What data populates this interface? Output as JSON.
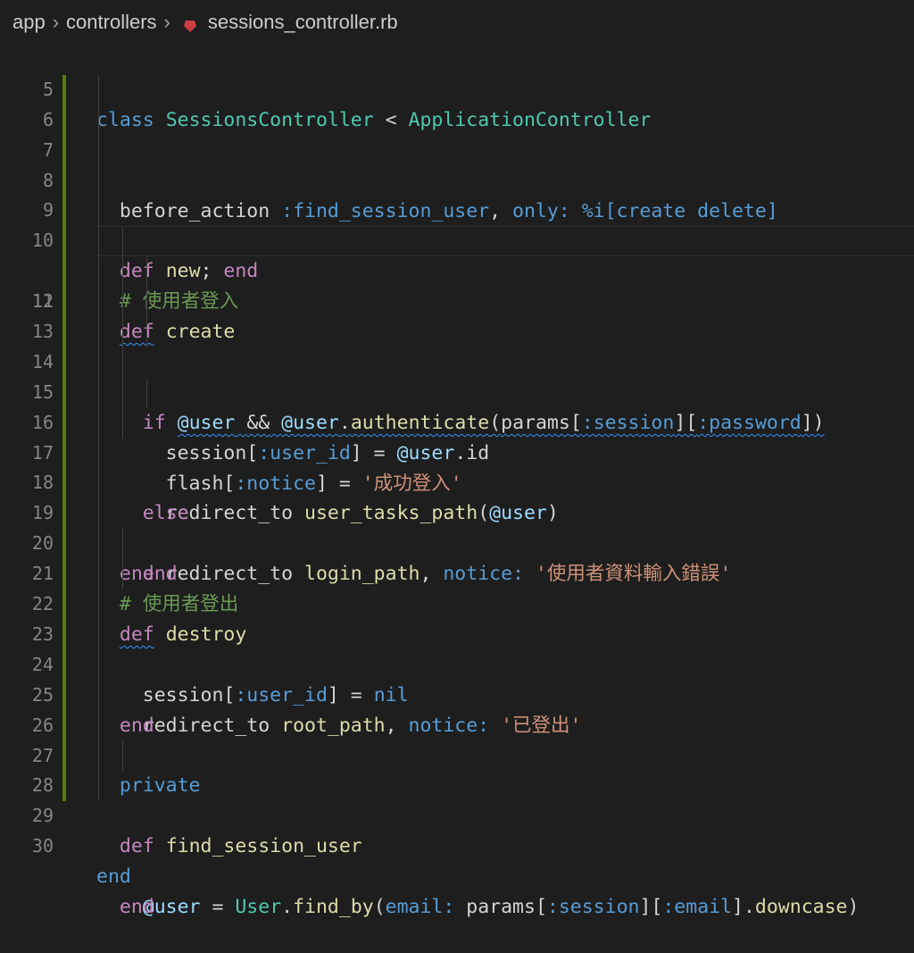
{
  "breadcrumb": {
    "part1": "app",
    "part2": "controllers",
    "file": "sessions_controller.rb",
    "icon": "ruby-icon"
  },
  "editor": {
    "lines": [
      {
        "n": "5"
      },
      {
        "n": "6"
      },
      {
        "n": "7"
      },
      {
        "n": "8"
      },
      {
        "n": "9"
      },
      {
        "n": "10"
      },
      {
        "n": "11"
      },
      {
        "n": "12"
      },
      {
        "n": "13"
      },
      {
        "n": "14"
      },
      {
        "n": "15"
      },
      {
        "n": "16"
      },
      {
        "n": "17"
      },
      {
        "n": "18"
      },
      {
        "n": "19"
      },
      {
        "n": "20"
      },
      {
        "n": "21"
      },
      {
        "n": "22"
      },
      {
        "n": "23"
      },
      {
        "n": "24"
      },
      {
        "n": "25"
      },
      {
        "n": "26"
      },
      {
        "n": "27"
      },
      {
        "n": "28"
      },
      {
        "n": "29"
      },
      {
        "n": "30"
      }
    ],
    "tokens": {
      "l5": [
        "class",
        "SessionsController",
        "<",
        "ApplicationController"
      ],
      "l6": [
        "before_action",
        ":find_session_user",
        "only:",
        "%i[create delete]"
      ],
      "l8": [
        "def",
        "new",
        "end"
      ],
      "l9": "# 使用者登入",
      "l10": [
        "def",
        "create"
      ],
      "l11": [
        "if",
        "@user",
        "&&",
        "@user",
        "authenticate",
        "params",
        ":session",
        ":password"
      ],
      "l12": [
        "session",
        ":user_id",
        "@user",
        "id"
      ],
      "l13": [
        "flash",
        ":notice",
        "'成功登入'"
      ],
      "l14": [
        "redirect_to",
        "user_tasks_path",
        "@user"
      ],
      "l15": "else",
      "l16": [
        "redirect_to",
        "login_path",
        "notice:",
        "'使用者資料輸入錯誤'"
      ],
      "l17": "end",
      "l18": "end",
      "l19": "# 使用者登出",
      "l20": [
        "def",
        "destroy"
      ],
      "l21": [
        "session",
        ":user_id",
        "nil"
      ],
      "l22": [
        "redirect_to",
        "root_path",
        "notice:",
        "'已登出'"
      ],
      "l23": "end",
      "l25": "private",
      "l27": [
        "def",
        "find_session_user"
      ],
      "l28": [
        "@user",
        "User",
        "find_by",
        "email:",
        "params",
        ":session",
        ":email",
        "downcase"
      ],
      "l29": "end",
      "l30": "end"
    }
  },
  "colors": {
    "background": "#1e1e1e",
    "keyword": "#c586c0",
    "function": "#dcdcaa",
    "class": "#4ec9b0",
    "string": "#ce9178",
    "symbol": "#569cd6",
    "comment": "#6a9955",
    "git_modified": "#587c0c"
  }
}
